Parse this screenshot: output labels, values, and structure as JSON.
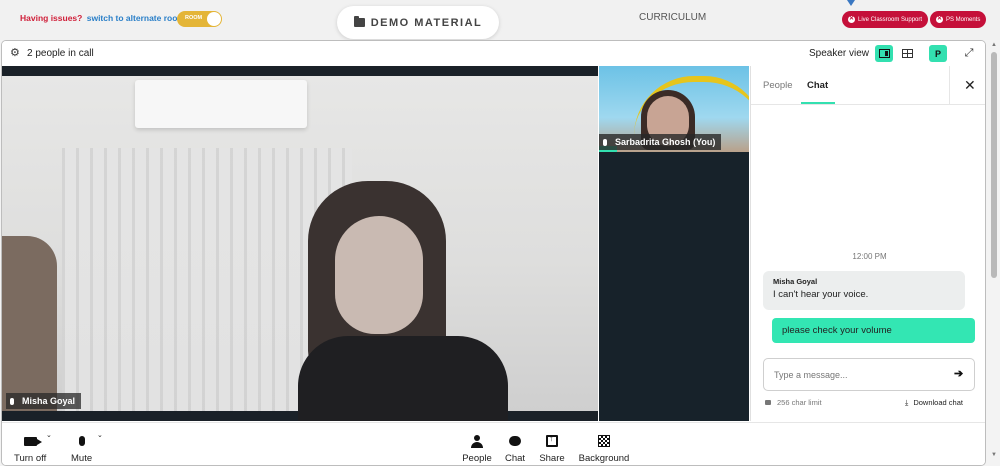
{
  "topbar": {
    "issues_text": "Having issues?",
    "alternate_link": "switch to alternate room",
    "room_toggle_label": "ROOM",
    "demo_material_label": "DEMO MATERIAL",
    "curriculum_label": "CURRICULUM",
    "live_support_label": "Live Classroom Support",
    "ps_moments_label": "PS Moments"
  },
  "callbar": {
    "people_count": "2 people in call",
    "speaker_view_label": "Speaker view",
    "profile_initial": "P"
  },
  "video": {
    "main_participant": "Misha Goyal",
    "side_participant": "Sarbadrita Ghosh (You)"
  },
  "chat": {
    "tabs": [
      "People",
      "Chat"
    ],
    "active_tab": "Chat",
    "timestamp": "12:00 PM",
    "messages": [
      {
        "author": "Misha Goyal",
        "text": "I can't hear your voice.",
        "direction": "incoming"
      },
      {
        "author": "",
        "text": "please check your volume",
        "direction": "outgoing"
      }
    ],
    "input_placeholder": "Type a message...",
    "char_limit": "256 char limit",
    "download_label": "Download chat"
  },
  "bottombar": {
    "turn_off_label": "Turn off",
    "mute_label": "Mute",
    "people_label": "People",
    "chat_label": "Chat",
    "share_label": "Share",
    "background_label": "Background"
  },
  "colors": {
    "accent": "#33e0b0",
    "alert_red": "#c5103a",
    "toggle_yellow": "#e4b537",
    "link_blue": "#2a7fc8"
  },
  "icons": [
    "folder-icon",
    "gear-icon",
    "speaker-view-icon",
    "grid-view-icon",
    "fullscreen-icon",
    "close-icon",
    "send-icon",
    "lock-icon",
    "download-icon",
    "camera-icon",
    "mic-icon",
    "people-icon",
    "chat-icon",
    "share-icon",
    "background-icon"
  ]
}
